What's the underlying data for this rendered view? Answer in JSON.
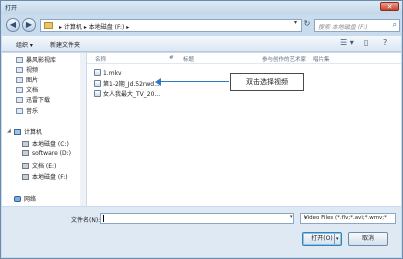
{
  "window": {
    "title": "打开",
    "close_glyph": "✕"
  },
  "address_bar": {
    "back_glyph": "◀",
    "forward_glyph": "▶",
    "breadcrumb": "▸ 计算机 ▸ 本地磁盘 (F:) ▸",
    "dropdown_glyph": "▾",
    "refresh_glyph": "↻",
    "search_placeholder": "搜索 本地磁盘 (F:)",
    "search_icon": "⌕"
  },
  "toolbar": {
    "organize": "组织 ▾",
    "new_folder": "新建文件夹",
    "view_icon": "☰ ▾",
    "pane_icon": "▯",
    "help_icon": "?"
  },
  "nav": {
    "items": [
      {
        "label": "暴风影视库",
        "icon": "folder-icon",
        "type": "lib"
      },
      {
        "label": "视频",
        "icon": "video-icon",
        "type": "lib"
      },
      {
        "label": "图片",
        "icon": "picture-icon",
        "type": "lib"
      },
      {
        "label": "文档",
        "icon": "document-icon",
        "type": "lib"
      },
      {
        "label": "迅雷下载",
        "icon": "download-icon",
        "type": "lib"
      },
      {
        "label": "音乐",
        "icon": "music-icon",
        "type": "lib"
      },
      {
        "label": "计算机",
        "icon": "computer-icon",
        "type": "pc"
      },
      {
        "label": "本地磁盘 (C:)",
        "icon": "drive-icon",
        "type": "drive"
      },
      {
        "label": "software (D:)",
        "icon": "drive-icon",
        "type": "drive"
      },
      {
        "label": "文档 (E:)",
        "icon": "drive-icon",
        "type": "drive"
      },
      {
        "label": "本地磁盘 (F:)",
        "icon": "drive-icon",
        "type": "drive"
      },
      {
        "label": "网络",
        "icon": "network-icon",
        "type": "net"
      }
    ]
  },
  "columns": {
    "name": "名称",
    "number": "#",
    "title": "标题",
    "artists": "参与创作的艺术家",
    "album": "唱片集"
  },
  "files": [
    {
      "name": "1.mkv"
    },
    {
      "name": "第1-2期_Jd.52rwd..."
    },
    {
      "name": "女人我最大_TV_20..."
    }
  ],
  "callout": "双击选择视频",
  "footer": {
    "filename_label": "文件名(N):",
    "filename_value": "",
    "filetype": "Video Files (*.flv;*.avi;*.wmv;*",
    "open": "打开(O)",
    "cancel": "取消"
  }
}
